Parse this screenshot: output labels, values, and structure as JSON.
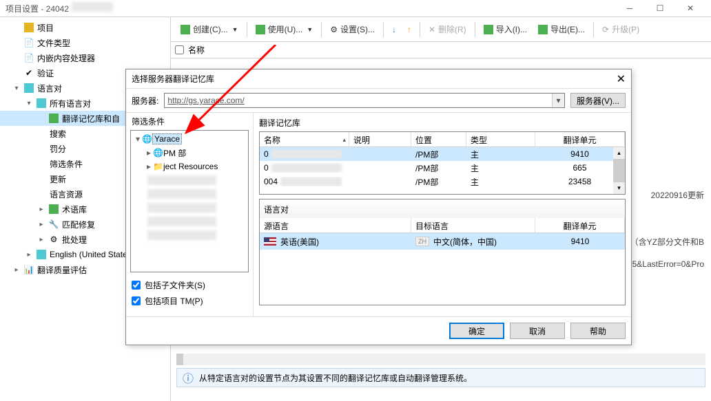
{
  "window": {
    "title": "项目设置 - 24042"
  },
  "sidebar": {
    "items": [
      {
        "label": "项目",
        "expander": ""
      },
      {
        "label": "文件类型",
        "expander": ""
      },
      {
        "label": "内嵌内容处理器",
        "expander": ""
      },
      {
        "label": "验证",
        "expander": ""
      },
      {
        "label": "语言对",
        "expander": "▾"
      },
      {
        "label": "所有语言对",
        "expander": "▾"
      },
      {
        "label": "翻译记忆库和自",
        "selected": true
      },
      {
        "label": "搜索"
      },
      {
        "label": "罚分"
      },
      {
        "label": "筛选条件"
      },
      {
        "label": "更新"
      },
      {
        "label": "语言资源"
      },
      {
        "label": "术语库",
        "expander": "▸"
      },
      {
        "label": "匹配修复",
        "expander": "▸"
      },
      {
        "label": "批处理",
        "expander": "▸"
      },
      {
        "label": "English (United State",
        "expander": "▸"
      },
      {
        "label": "翻译质量评估",
        "expander": "▸"
      }
    ]
  },
  "toolbar": {
    "create": "创建(C)...",
    "use": "使用(U)...",
    "settings": "设置(S)...",
    "delete": "删除(R)",
    "import": "导入(I)...",
    "export": "导出(E)...",
    "upgrade": "升级(P)"
  },
  "listheader": {
    "name": "名称"
  },
  "modal": {
    "title": "选择服务器翻译记忆库",
    "server_label": "服务器:",
    "server_url": "http://gs.yarace.com/",
    "server_button": "服务器(V)...",
    "filter": {
      "header": "筛选条件",
      "root": "Yarace",
      "pm": "PM 部",
      "proj": "ject Resources",
      "include_sub": "包括子文件夹(S)",
      "include_tm": "包括项目 TM(P)"
    },
    "tm": {
      "header": "翻译记忆库",
      "cols": {
        "name": "名称",
        "desc": "说明",
        "loc": "位置",
        "type": "类型",
        "units": "翻译单元"
      },
      "rows": [
        {
          "name": "0",
          "loc": "/PM部",
          "type": "主",
          "units": "9410"
        },
        {
          "name": "0",
          "loc": "/PM部",
          "type": "主",
          "units": "665"
        },
        {
          "name": "004",
          "loc": "/PM部",
          "type": "主",
          "units": "23458"
        }
      ]
    },
    "lang": {
      "header": "语言对",
      "cols": {
        "src": "源语言",
        "tgt": "目标语言",
        "units": "翻译单元"
      },
      "row": {
        "src": "英语(美国)",
        "tgt_badge": "ZH",
        "tgt": "中文(简体，中国)",
        "units": "9410"
      }
    },
    "buttons": {
      "ok": "确定",
      "cancel": "取消",
      "help": "帮助"
    }
  },
  "infobar": "从特定语言对的设置节点为其设置不同的翻译记忆库或自动翻译管理系统。",
  "bgtexts": {
    "t1": "20220916更新",
    "t2": "25（含YZ部分文件和B",
    "t3": "63ab5&LastError=0&Pro"
  }
}
